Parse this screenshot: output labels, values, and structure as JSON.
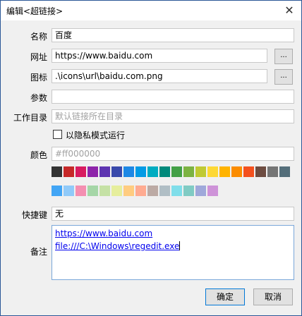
{
  "window": {
    "title": "编辑<超链接>",
    "close_glyph": "✕"
  },
  "form": {
    "name_label": "名称",
    "name_value": "百度",
    "url_label": "网址",
    "url_value": "https://www.baidu.com",
    "url_browse": "...",
    "icon_label": "图标",
    "icon_value": ".\\icons\\url\\baidu.com.png",
    "icon_browse": "...",
    "params_label": "参数",
    "params_value": "",
    "workdir_label": "工作目录",
    "workdir_placeholder": "默认链接所在目录",
    "private_mode_label": "以隐私模式运行",
    "color_label": "颜色",
    "color_value": "#ff000000",
    "hotkey_label": "快捷键",
    "hotkey_value": "无",
    "notes_label": "备注",
    "notes_lines": [
      "https://www.baidu.com",
      "file:///C:\\Windows\\regedit.exe"
    ]
  },
  "palette_row1": [
    "#333333",
    "#c62828",
    "#d81b60",
    "#8e24aa",
    "#5e35b1",
    "#3949ab",
    "#1e88e5",
    "#039be5",
    "#00acc1",
    "#00897b",
    "#43a047",
    "#7cb342",
    "#c0ca33",
    "#fdd835",
    "#ffb300",
    "#fb8c00",
    "#f4511e",
    "#6d4c41",
    "#757575",
    "#546e7a"
  ],
  "palette_row2": [
    "#42a5f5",
    "#90caf9",
    "#f48fb1",
    "#a5d6a7",
    "#c5e1a5",
    "#e6ee9c",
    "#ffcc80",
    "#ffab91",
    "#bcaaa4",
    "#b0bec5",
    "#80deea",
    "#80cbc4",
    "#9fa8da",
    "#ce93d8"
  ],
  "buttons": {
    "ok_label": "确定",
    "cancel_label": "取消"
  }
}
